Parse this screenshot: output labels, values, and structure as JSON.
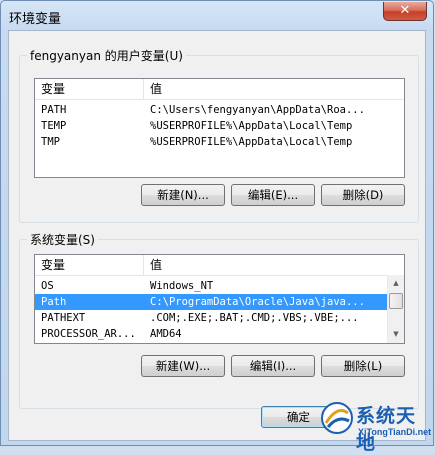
{
  "window": {
    "title": "环境变量",
    "close_glyph": "✕"
  },
  "user_vars": {
    "group_label": "fengyanyan 的用户变量(U)",
    "headers": [
      "变量",
      "值"
    ],
    "rows": [
      {
        "name": "PATH",
        "value": "C:\\Users\\fengyanyan\\AppData\\Roa..."
      },
      {
        "name": "TEMP",
        "value": "%USERPROFILE%\\AppData\\Local\\Temp"
      },
      {
        "name": "TMP",
        "value": "%USERPROFILE%\\AppData\\Local\\Temp"
      }
    ],
    "buttons": {
      "new": "新建(N)...",
      "edit": "编辑(E)...",
      "delete": "删除(D)"
    }
  },
  "system_vars": {
    "group_label": "系统变量(S)",
    "headers": [
      "变量",
      "值"
    ],
    "rows": [
      {
        "name": "OS",
        "value": "Windows_NT",
        "selected": false
      },
      {
        "name": "Path",
        "value": "C:\\ProgramData\\Oracle\\Java\\java...",
        "selected": true
      },
      {
        "name": "PATHEXT",
        "value": ".COM;.EXE;.BAT;.CMD;.VBS;.VBE;...",
        "selected": false
      },
      {
        "name": "PROCESSOR_AR...",
        "value": "AMD64",
        "selected": false
      }
    ],
    "buttons": {
      "new": "新建(W)...",
      "edit": "编辑(I)...",
      "delete": "删除(L)"
    },
    "scroll": {
      "up_glyph": "▲",
      "down_glyph": "▼"
    }
  },
  "footer": {
    "ok": "确定"
  },
  "watermark": {
    "text": "系统天地",
    "sub": "XiTongTianDi.net"
  },
  "colors": {
    "selection": "#3399ff",
    "titlebar": "#c7daf0",
    "close_button": "#c5402a",
    "watermark": "#1a5fb4"
  }
}
